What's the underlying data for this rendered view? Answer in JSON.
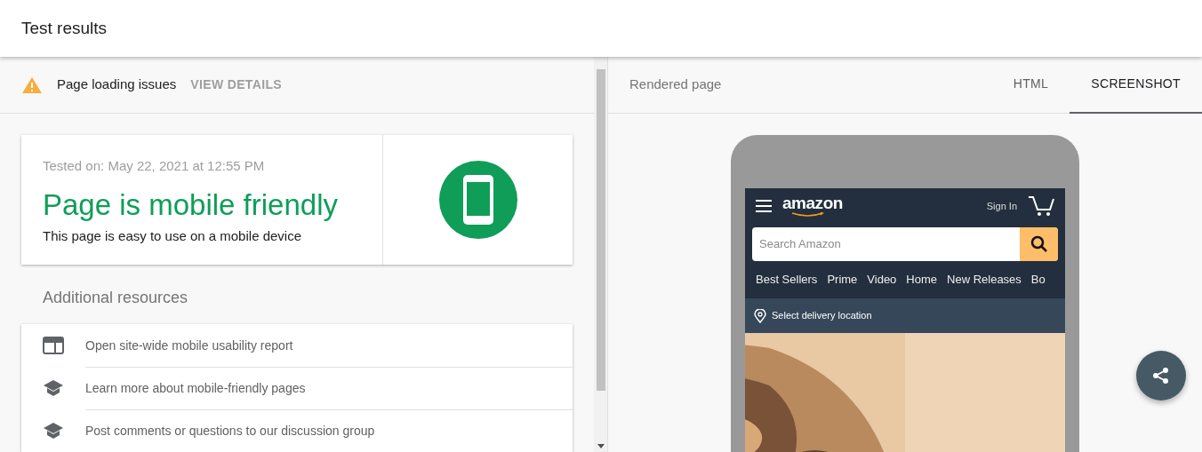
{
  "header": {
    "title": "Test results"
  },
  "issues": {
    "label": "Page loading issues",
    "action": "VIEW DETAILS"
  },
  "result": {
    "tested_on": "Tested on: May 22, 2021 at 12:55 PM",
    "verdict": "Page is mobile friendly",
    "description": "This page is easy to use on a mobile device"
  },
  "resources": {
    "title": "Additional resources",
    "items": [
      {
        "kind": "report",
        "label": "Open site-wide mobile usability report"
      },
      {
        "kind": "learn",
        "label": "Learn more about mobile-friendly pages"
      },
      {
        "kind": "learn",
        "label": "Post comments or questions to our discussion group"
      }
    ]
  },
  "rendered": {
    "title": "Rendered page",
    "tabs": [
      {
        "label": "HTML",
        "selected": false
      },
      {
        "label": "SCREENSHOT",
        "selected": true
      }
    ]
  },
  "phone": {
    "logo": "amazon",
    "sign_in": "Sign In",
    "search_placeholder": "Search Amazon",
    "nav": [
      "Best Sellers",
      "Prime",
      "Video",
      "Home",
      "New Releases",
      "Bo"
    ],
    "location": "Select delivery location"
  }
}
